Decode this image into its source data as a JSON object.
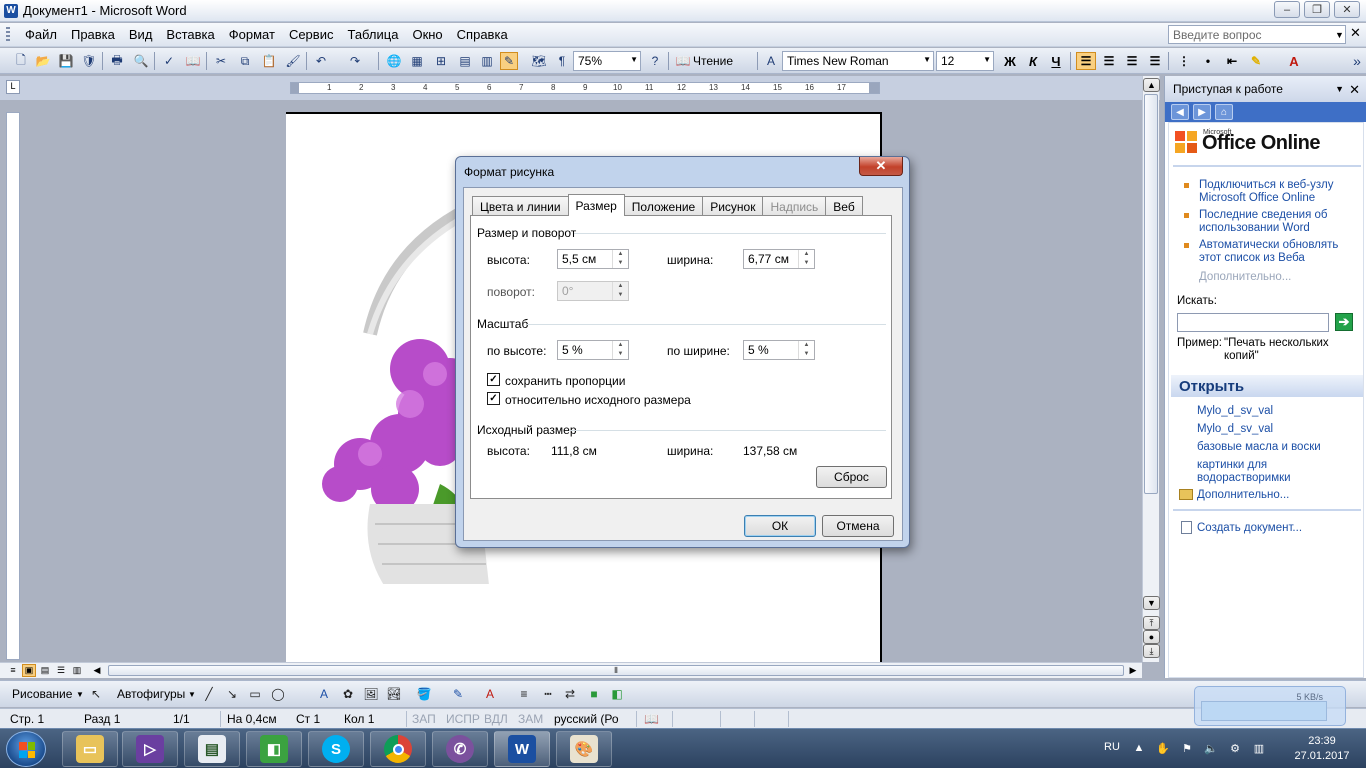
{
  "window": {
    "title": "Документ1 - Microsoft Word",
    "app_icon": "W",
    "controls": [
      "–",
      "❐",
      "✕"
    ]
  },
  "menu": [
    "Файл",
    "Правка",
    "Вид",
    "Вставка",
    "Формат",
    "Сервис",
    "Таблица",
    "Окно",
    "Справка"
  ],
  "ask_placeholder": "Введите вопрос",
  "toolbar": {
    "zoom": "75%",
    "reading": "Чтение",
    "font": "Times New Roman",
    "size": "12",
    "bold": "Ж",
    "italic": "К",
    "underline": "Ч",
    "accent": "#f9cf80"
  },
  "ruler_numbers": [
    "1",
    "2",
    "3",
    "4",
    "5",
    "6",
    "7",
    "8",
    "9",
    "10",
    "11",
    "12",
    "13",
    "14",
    "15",
    "16",
    "17"
  ],
  "taskpane": {
    "title": "Приступая к работе",
    "logo_small": "Microsoft",
    "logo": "Office Online",
    "links": [
      "Подключиться к веб-узлу Microsoft Office Online",
      "Последние сведения об использовании Word",
      "Автоматически обновлять этот список из Веба"
    ],
    "more": "Дополнительно...",
    "search_label": "Искать:",
    "example_label": "Пример:",
    "example_text": "\"Печать нескольких копий\"",
    "open_title": "Открыть",
    "recent": [
      "Mylo_d_sv_val",
      "Mylo_d_sv_val",
      "базовые масла и воски",
      "картинки для водорастворимки"
    ],
    "open_more": "Дополнительно...",
    "create": "Создать документ..."
  },
  "dialog": {
    "title": "Формат рисунка",
    "tabs": [
      {
        "label": "Цвета и линии",
        "state": "normal"
      },
      {
        "label": "Размер",
        "state": "active"
      },
      {
        "label": "Положение",
        "state": "normal"
      },
      {
        "label": "Рисунок",
        "state": "normal"
      },
      {
        "label": "Надпись",
        "state": "disabled"
      },
      {
        "label": "Веб",
        "state": "normal"
      }
    ],
    "group_size": "Размер и поворот",
    "height_label": "высота:",
    "height_value": "5,5 см",
    "width_label": "ширина:",
    "width_value": "6,77 см",
    "rotation_label": "поворот:",
    "rotation_value": "0°",
    "group_scale": "Масштаб",
    "scale_h_label": "по высоте:",
    "scale_h_value": "5 %",
    "scale_w_label": "по ширине:",
    "scale_w_value": "5 %",
    "keep_ratio": "сохранить пропорции",
    "keep_ratio_checked": true,
    "relative": "относительно исходного размера",
    "relative_checked": true,
    "group_original": "Исходный размер",
    "orig_h_label": "высота:",
    "orig_h_value": "111,8 см",
    "orig_w_label": "ширина:",
    "orig_w_value": "137,58 см",
    "reset": "Сброс",
    "ok": "ОК",
    "cancel": "Отмена"
  },
  "drawbar": {
    "drawing": "Рисование",
    "autoshapes": "Автофигуры"
  },
  "status": {
    "page": "Стр. 1",
    "section": "Разд 1",
    "pages": "1/1",
    "at": "На 0,4см",
    "line": "Ст 1",
    "col": "Кол 1",
    "rec": "ЗАП",
    "trk": "ИСПР",
    "ext": "ВДЛ",
    "ovr": "ЗАМ",
    "lang": "русский (Ро"
  },
  "gadget": {
    "speed": "5 KB/s"
  },
  "taskbar": {
    "lang": "RU",
    "time": "23:39",
    "date": "27.01.2017"
  }
}
